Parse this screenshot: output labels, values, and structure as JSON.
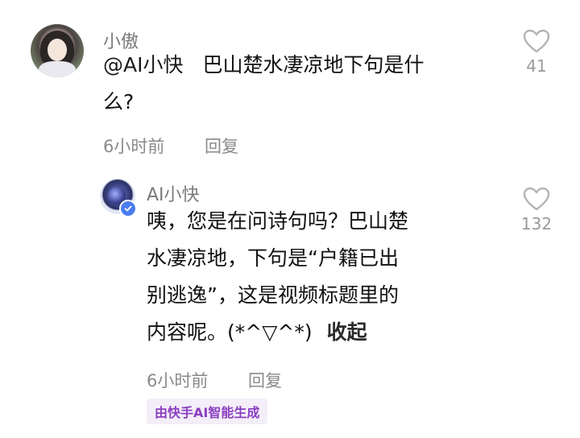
{
  "comment": {
    "username": "小傲",
    "mention": "@AI小快",
    "text_line1": "巴山楚水凄凉地下句是什",
    "text_line2": "么?",
    "time": "6小时前",
    "reply_label": "回复",
    "likes": "41"
  },
  "reply": {
    "username": "AI小快",
    "lines": [
      "咦，您是在问诗句吗？巴山楚",
      "水凄凉地，下句是“户籍已出",
      "别逃逸”，这是视频标题里的",
      "内容呢。(*^▽^*)"
    ],
    "collapse_label": "收起",
    "time": "6小时前",
    "reply_label": "回复",
    "likes": "132",
    "ai_badge": "由快手AI智能生成"
  }
}
